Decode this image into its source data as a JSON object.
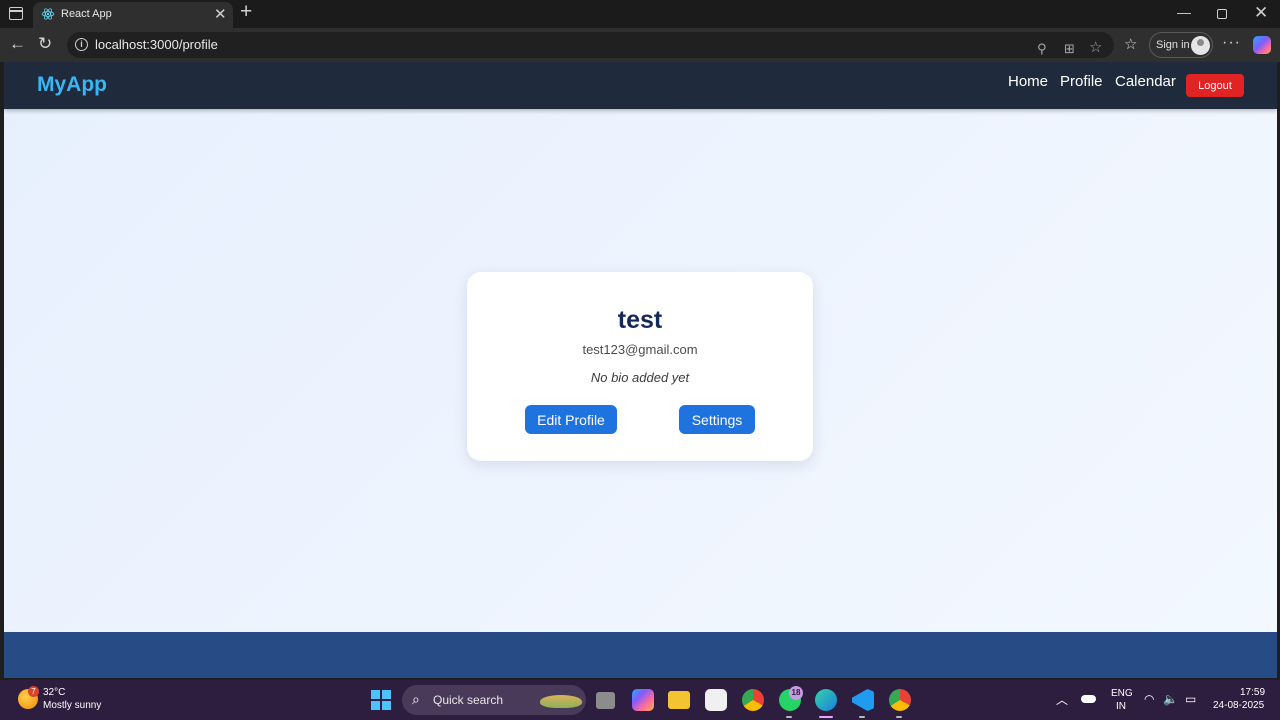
{
  "browser": {
    "tab_title": "React App",
    "url": "localhost:3000/profile",
    "sign_in_label": "Sign in"
  },
  "navbar": {
    "brand": "MyApp",
    "links": [
      "Home",
      "Profile",
      "Calendar"
    ],
    "logout_label": "Logout"
  },
  "profile": {
    "name": "test",
    "email": "test123@gmail.com",
    "bio": "No bio added yet",
    "edit_label": "Edit Profile",
    "settings_label": "Settings"
  },
  "taskbar": {
    "weather_badge": "7",
    "weather_temp": "32°C",
    "weather_desc": "Mostly sunny",
    "search_label": "Quick search",
    "whatsapp_badge": "18",
    "lang_line1": "ENG",
    "lang_line2": "IN",
    "time": "17:59",
    "date": "24-08-2025"
  },
  "colors": {
    "navbar_bg": "#1f2a3d",
    "brand": "#3ab6f5",
    "logout": "#e02424",
    "primary_button": "#1f73de",
    "name_text": "#15285a",
    "footer_bg": "#264b85"
  },
  "icons": [
    "tab-actions-icon",
    "react-favicon-icon",
    "close-icon",
    "plus-icon",
    "minimize-icon",
    "maximize-icon",
    "back-icon",
    "reload-icon",
    "info-icon",
    "read-aloud-icon",
    "extensions-icon",
    "star-icon",
    "favorites-icon",
    "more-icon",
    "copilot-icon",
    "weather-icon",
    "windows-start-icon",
    "search-icon",
    "task-view-icon",
    "copilot-app-icon",
    "file-explorer-icon",
    "store-icon",
    "chrome-icon",
    "whatsapp-icon",
    "edge-icon",
    "vscode-icon",
    "chrome-profile-icon",
    "chevron-up-icon",
    "onedrive-icon",
    "wifi-icon",
    "volume-icon",
    "battery-icon"
  ]
}
